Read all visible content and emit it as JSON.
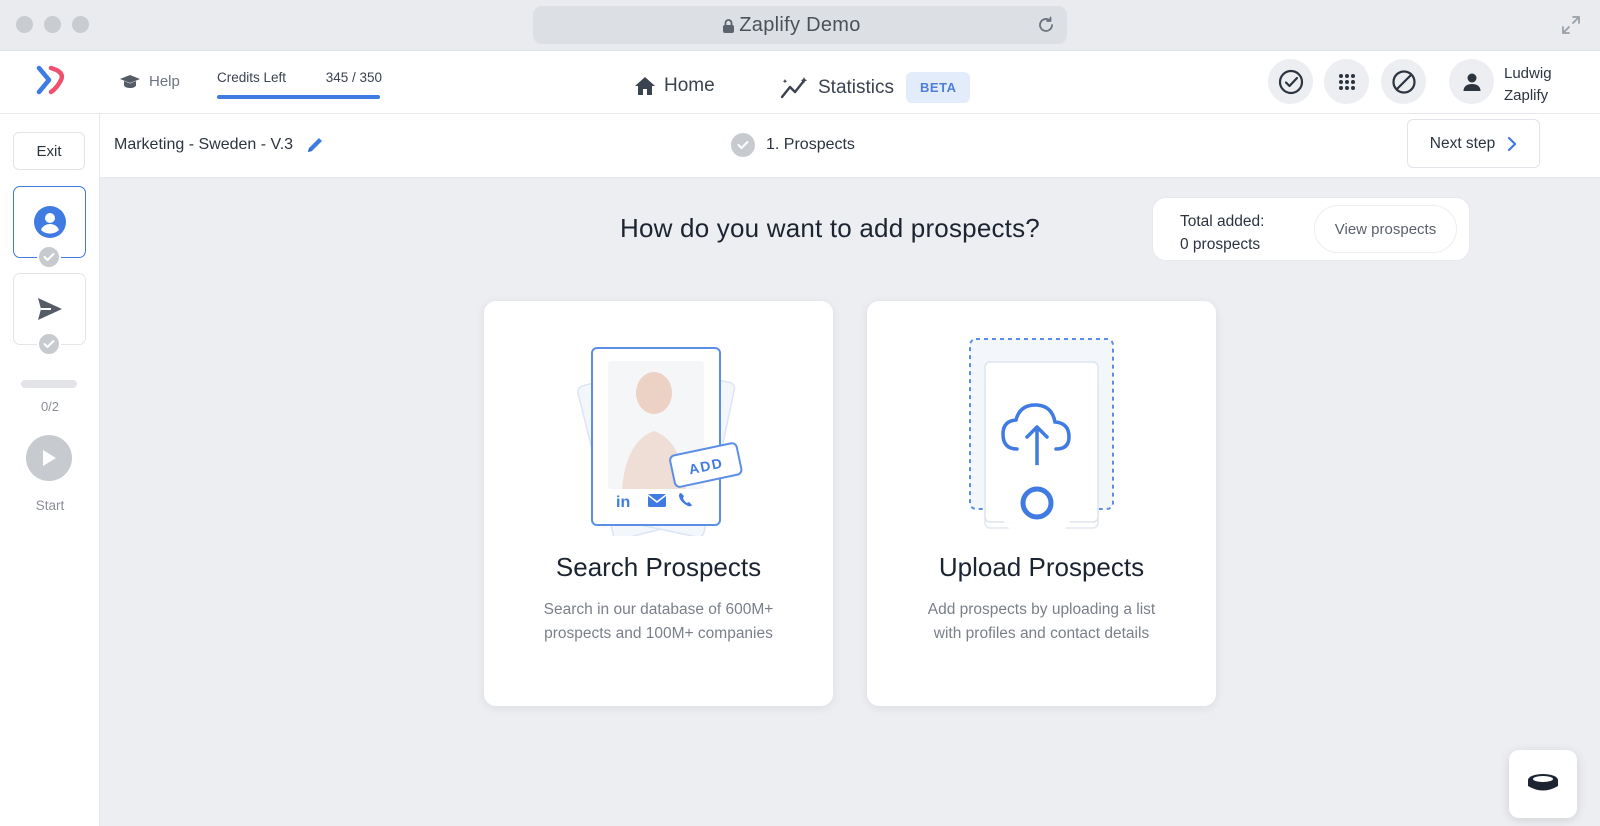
{
  "browser": {
    "title": "Zaplify Demo"
  },
  "header": {
    "help_label": "Help",
    "credits_label": "Credits Left",
    "credits_value": "345 / 350",
    "credits_used_fraction": 0.986,
    "nav_home": "Home",
    "nav_statistics": "Statistics",
    "beta_badge": "BETA",
    "user_name": "Ludwig",
    "user_company": "Zaplify"
  },
  "rail": {
    "exit_label": "Exit",
    "progress_count": "0/2",
    "start_label": "Start"
  },
  "subheader": {
    "campaign_name": "Marketing - Sweden - V.3",
    "current_step": "1. Prospects",
    "next_step_label": "Next step"
  },
  "content": {
    "question": "How do you want to add prospects?",
    "total_added_label": "Total added:",
    "total_added_value": "0 prospects",
    "view_prospects_label": "View prospects",
    "cards": [
      {
        "title": "Search Prospects",
        "desc_line1": "Search in our database of 600M+",
        "desc_line2": "prospects and 100M+ companies",
        "badge": "ADD"
      },
      {
        "title": "Upload Prospects",
        "desc_line1": "Add prospects by uploading a list",
        "desc_line2": "with profiles and contact details"
      }
    ]
  },
  "colors": {
    "accent": "#3f7be2",
    "text": "#1c2431",
    "muted": "#7a808a",
    "background": "#eceef1"
  }
}
